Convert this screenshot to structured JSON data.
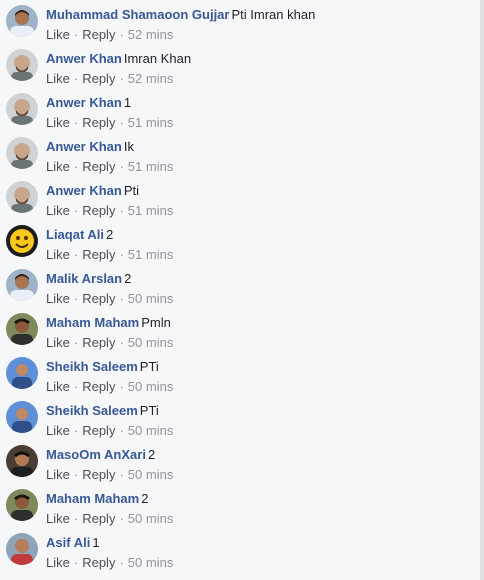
{
  "actions": {
    "like": "Like",
    "reply": "Reply",
    "separator": "·"
  },
  "comments": [
    {
      "author": "Muhammad Shamaoon Gujjar",
      "text": "Pti Imran khan",
      "time": "52 mins",
      "avatar_icon": "profile-photo-man"
    },
    {
      "author": "Anwer Khan",
      "text": "Imran Khan",
      "time": "52 mins",
      "avatar_icon": "profile-photo-bald-man"
    },
    {
      "author": "Anwer Khan",
      "text": "1",
      "time": "51 mins",
      "avatar_icon": "profile-photo-bald-man"
    },
    {
      "author": "Anwer Khan",
      "text": "Ik",
      "time": "51 mins",
      "avatar_icon": "profile-photo-bald-man"
    },
    {
      "author": "Anwer Khan",
      "text": "Pti",
      "time": "51 mins",
      "avatar_icon": "profile-photo-bald-man"
    },
    {
      "author": "Liaqat Ali",
      "text": "2",
      "time": "51 mins",
      "avatar_icon": "emoji-thumbs-up"
    },
    {
      "author": "Malik Arslan",
      "text": "2",
      "time": "50 mins",
      "avatar_icon": "profile-photo-man"
    },
    {
      "author": "Maham Maham",
      "text": "Pmln",
      "time": "50 mins",
      "avatar_icon": "profile-photo-man-outdoor"
    },
    {
      "author": "Sheikh Saleem",
      "text": "PTi",
      "time": "50 mins",
      "avatar_icon": "profile-photo-man-blue"
    },
    {
      "author": "Sheikh Saleem",
      "text": "PTi",
      "time": "50 mins",
      "avatar_icon": "profile-photo-man-blue"
    },
    {
      "author": "MasoOm AnXari",
      "text": "2",
      "time": "50 mins",
      "avatar_icon": "profile-photo-man-dark"
    },
    {
      "author": "Maham Maham",
      "text": "2",
      "time": "50 mins",
      "avatar_icon": "profile-photo-man-outdoor"
    },
    {
      "author": "Asif Ali",
      "text": "1",
      "time": "50 mins",
      "avatar_icon": "profile-photo-man-red"
    }
  ]
}
